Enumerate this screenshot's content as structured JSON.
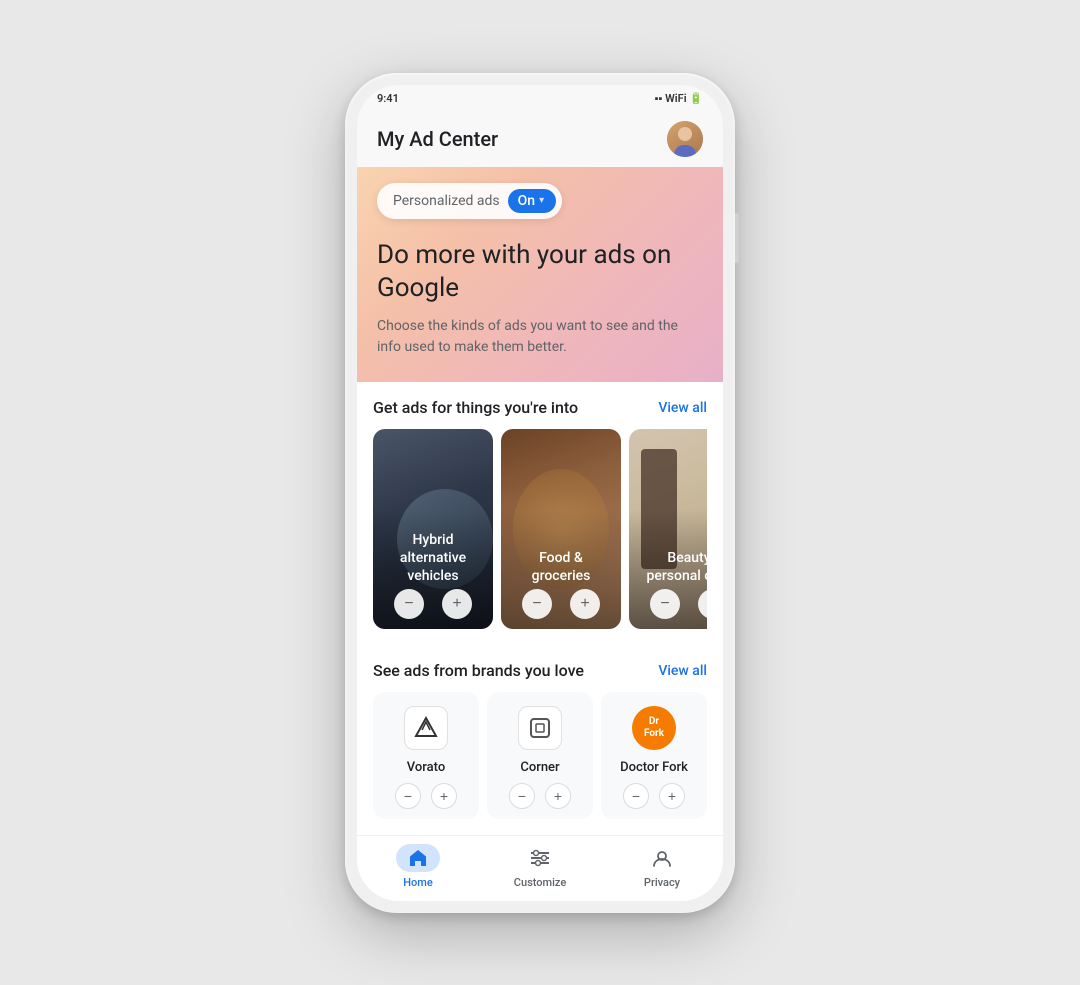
{
  "header": {
    "title": "My Ad Center"
  },
  "hero": {
    "personalized_label": "Personalized ads",
    "on_label": "On",
    "title": "Do more with your ads on Google",
    "subtitle": "Choose the kinds of ads you want to see and the info used to make them better."
  },
  "interests_section": {
    "title": "Get ads for things you're into",
    "view_all": "View all",
    "cards": [
      {
        "label": "Hybrid alternative vehicles",
        "theme": "hybrid"
      },
      {
        "label": "Food & groceries",
        "theme": "food"
      },
      {
        "label": "Beauty personal care",
        "theme": "beauty"
      }
    ]
  },
  "brands_section": {
    "title": "See ads from brands you love",
    "view_all": "View all",
    "brands": [
      {
        "name": "Vorato",
        "icon_type": "vorato"
      },
      {
        "name": "Corner",
        "icon_type": "corner"
      },
      {
        "name": "Doctor Fork",
        "icon_type": "doctorfork"
      }
    ]
  },
  "bottom_nav": {
    "items": [
      {
        "label": "Home",
        "icon": "home",
        "active": true
      },
      {
        "label": "Customize",
        "icon": "customize",
        "active": false
      },
      {
        "label": "Privacy",
        "icon": "privacy",
        "active": false
      }
    ]
  },
  "icons": {
    "chevron_down": "▾",
    "minus": "−",
    "plus": "+"
  }
}
